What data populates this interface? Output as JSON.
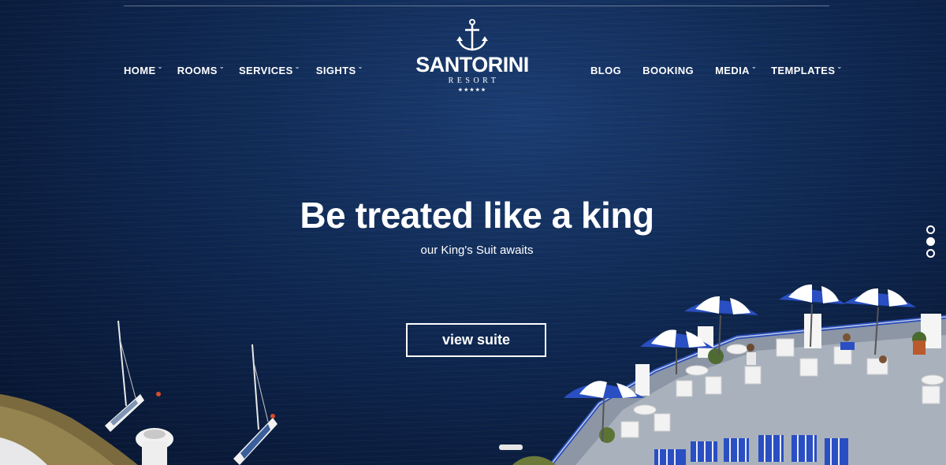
{
  "nav_left": [
    {
      "label": "HOME",
      "has_dropdown": true
    },
    {
      "label": "ROOMS",
      "has_dropdown": true
    },
    {
      "label": "SERVICES",
      "has_dropdown": true
    },
    {
      "label": "SIGHTS",
      "has_dropdown": true
    }
  ],
  "nav_right": [
    {
      "label": "BLOG",
      "has_dropdown": false
    },
    {
      "label": "BOOKING",
      "has_dropdown": false
    },
    {
      "label": "MEDIA",
      "has_dropdown": true
    },
    {
      "label": "TEMPLATES",
      "has_dropdown": true
    }
  ],
  "logo": {
    "icon": "anchor-icon",
    "title": "SANTORINI",
    "subtitle": "RESORT",
    "stars": "★★★★★"
  },
  "hero": {
    "headline": "Be treated like a king",
    "subline": "our King's Suit awaits",
    "cta_label": "view suite"
  },
  "slider": {
    "dot_count": 3,
    "active_index": 1
  },
  "icons": {
    "dropdown": "chevron-down-icon"
  },
  "colors": {
    "sea": "#112c58",
    "text": "#ffffff",
    "umbrella_blue": "#2a4fc2"
  }
}
